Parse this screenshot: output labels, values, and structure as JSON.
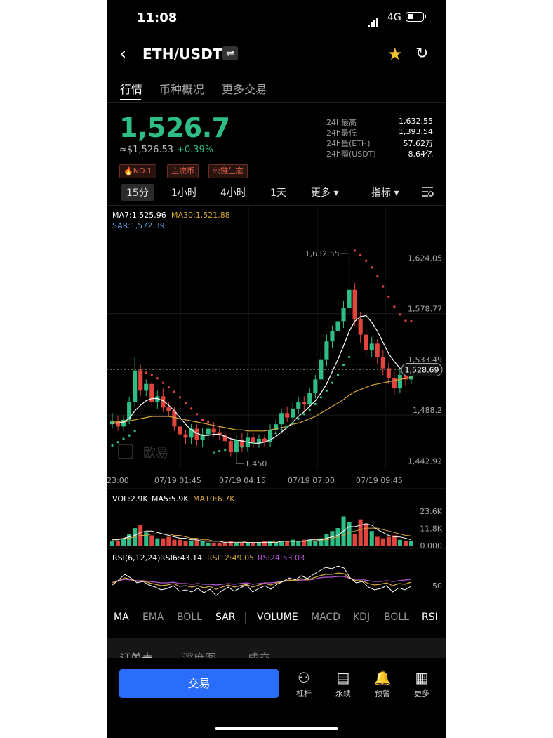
{
  "status_bar": {
    "time": "11:08",
    "network": "4G"
  },
  "header": {
    "back": "‹",
    "pair": "ETH/USDT",
    "swap_icon": "⇌",
    "star_icon": "★",
    "share_icon": "↻"
  },
  "tabs": [
    {
      "label": "行情"
    },
    {
      "label": "币种概况"
    },
    {
      "label": "更多交易"
    }
  ],
  "ticker": {
    "price": "1,526.7",
    "fiat": "≈$1,526.53",
    "change": "+0.39%",
    "stats": [
      {
        "label": "24h最高",
        "value": "1,632.55"
      },
      {
        "label": "24h最低",
        "value": "1,393.54"
      },
      {
        "label": "24h量(ETH)",
        "value": "57.62万"
      },
      {
        "label": "24h额(USDT)",
        "value": "8.64亿"
      }
    ],
    "tags": [
      "🔥NO.1",
      "主流币",
      "公链生态"
    ]
  },
  "timeframes": [
    {
      "label": "15分"
    },
    {
      "label": "1小时"
    },
    {
      "label": "4小时"
    },
    {
      "label": "1天"
    },
    {
      "label": "更多 ▾"
    },
    {
      "label": "指标 ▾"
    }
  ],
  "main_legend": {
    "ma7": "MA7:1,525.96",
    "ma30": "MA30:1,521.88",
    "sar": "SAR:1,572.39"
  },
  "price_axis": [
    "1,624.05",
    "1,578.77",
    "1,533.49",
    "1,488.2",
    "1,442.92"
  ],
  "current_price_tag": "1,528.69",
  "high_marker": "1,632.55",
  "low_marker": "1,450",
  "watermark": "欧易",
  "time_axis": [
    "23:00",
    "07/19 01:45",
    "07/19 04:15",
    "07/19 07:00",
    "07/19 09:45"
  ],
  "volume_legend": {
    "vol": "VOL:2.9K",
    "ma5": "MA5:5.9K",
    "ma10": "MA10:6.7K"
  },
  "volume_axis": [
    "23.6K",
    "11.8K",
    "0.000"
  ],
  "rsi_legend": {
    "label": "RSI(6,12,24)",
    "rsi6": "RSI6:43.14",
    "rsi12": "RSI12:49.05",
    "rsi24": "RSI24:53.03"
  },
  "rsi_axis": "50",
  "indicator_tabs": [
    "MA",
    "EMA",
    "BOLL",
    "SAR",
    "VOLUME",
    "MACD",
    "KDJ",
    "BOLL",
    "RSI"
  ],
  "orderbook_tabs": [
    "订单表",
    "深度图",
    "成交"
  ],
  "bottom_nav": {
    "trade_button": "交易",
    "items": [
      {
        "label": "杠杆",
        "icon": "⚇"
      },
      {
        "label": "永续",
        "icon": "▤"
      },
      {
        "label": "预警",
        "icon": "🔔"
      },
      {
        "label": "更多",
        "icon": "▦"
      }
    ]
  },
  "colors": {
    "up": "#2ebd85",
    "down": "#e0443d",
    "ma7": "#ffffff",
    "ma30": "#d8a73a",
    "sar": "#5ba0e6",
    "rsi24": "#b657d6",
    "accent": "#2a6dfb"
  },
  "chart_data": [
    {
      "type": "candlestick",
      "y_axis_ticks": [
        1624.05,
        1578.77,
        1533.49,
        1488.2,
        1442.92
      ],
      "ylim": [
        1442.92,
        1650
      ],
      "x_tick_labels": [
        "23:00",
        "07/19 01:45",
        "07/19 04:15",
        "07/19 07:00",
        "07/19 09:45"
      ],
      "annotations": {
        "high": 1632.55,
        "low": 1450,
        "last": 1528.69
      },
      "candles": [
        [
          1480,
          1483,
          1476,
          1490
        ],
        [
          1483,
          1478,
          1474,
          1487
        ],
        [
          1478,
          1484,
          1474,
          1488
        ],
        [
          1484,
          1500,
          1480,
          1504
        ],
        [
          1500,
          1528,
          1495,
          1540
        ],
        [
          1528,
          1510,
          1505,
          1533
        ],
        [
          1510,
          1516,
          1505,
          1520
        ],
        [
          1516,
          1500,
          1495,
          1518
        ],
        [
          1500,
          1505,
          1494,
          1510
        ],
        [
          1505,
          1495,
          1491,
          1512
        ],
        [
          1495,
          1492,
          1487,
          1500
        ],
        [
          1492,
          1478,
          1474,
          1495
        ],
        [
          1478,
          1471,
          1466,
          1482
        ],
        [
          1471,
          1468,
          1462,
          1475
        ],
        [
          1468,
          1476,
          1462,
          1480
        ],
        [
          1476,
          1466,
          1461,
          1480
        ],
        [
          1466,
          1471,
          1460,
          1477
        ],
        [
          1471,
          1476,
          1466,
          1480
        ],
        [
          1476,
          1473,
          1469,
          1482
        ],
        [
          1473,
          1470,
          1466,
          1478
        ],
        [
          1470,
          1465,
          1461,
          1474
        ],
        [
          1465,
          1455,
          1451,
          1468
        ],
        [
          1455,
          1466,
          1450,
          1470
        ],
        [
          1466,
          1460,
          1455,
          1472
        ],
        [
          1460,
          1468,
          1456,
          1473
        ],
        [
          1468,
          1463,
          1459,
          1472
        ],
        [
          1463,
          1467,
          1459,
          1471
        ],
        [
          1467,
          1464,
          1460,
          1471
        ],
        [
          1464,
          1475,
          1460,
          1480
        ],
        [
          1475,
          1480,
          1472,
          1485
        ],
        [
          1480,
          1490,
          1476,
          1494
        ],
        [
          1490,
          1486,
          1482,
          1496
        ],
        [
          1486,
          1494,
          1483,
          1499
        ],
        [
          1494,
          1500,
          1489,
          1504
        ],
        [
          1500,
          1498,
          1492,
          1505
        ],
        [
          1498,
          1508,
          1495,
          1512
        ],
        [
          1508,
          1520,
          1503,
          1524
        ],
        [
          1520,
          1538,
          1516,
          1545
        ],
        [
          1538,
          1554,
          1532,
          1560
        ],
        [
          1554,
          1563,
          1548,
          1568
        ],
        [
          1563,
          1572,
          1556,
          1577
        ],
        [
          1572,
          1584,
          1566,
          1590
        ],
        [
          1584,
          1600,
          1576,
          1632.55
        ],
        [
          1600,
          1574,
          1568,
          1606
        ],
        [
          1574,
          1560,
          1553,
          1580
        ],
        [
          1560,
          1546,
          1540,
          1565
        ],
        [
          1546,
          1552,
          1540,
          1558
        ],
        [
          1552,
          1540,
          1534,
          1556
        ],
        [
          1540,
          1530,
          1524,
          1546
        ],
        [
          1530,
          1521,
          1516,
          1535
        ],
        [
          1521,
          1512,
          1506,
          1527
        ],
        [
          1512,
          1524,
          1508,
          1530
        ],
        [
          1524,
          1520,
          1514,
          1530
        ],
        [
          1520,
          1528.69,
          1516,
          1532
        ]
      ],
      "ma7": [
        1481,
        1481,
        1482,
        1485,
        1492,
        1497,
        1501,
        1503,
        1503,
        1501,
        1497,
        1492,
        1486,
        1480,
        1475,
        1472,
        1470,
        1470,
        1471,
        1471,
        1469,
        1467,
        1466,
        1465,
        1464,
        1463,
        1463,
        1464,
        1466,
        1469,
        1473,
        1477,
        1482,
        1487,
        1491,
        1496,
        1501,
        1508,
        1516,
        1527,
        1538,
        1550,
        1563,
        1572,
        1576,
        1577,
        1571,
        1563,
        1553,
        1543,
        1536,
        1530,
        1525,
        1526
      ],
      "ma30": [
        1482,
        1482,
        1482,
        1483,
        1484,
        1485,
        1486,
        1487,
        1487,
        1487,
        1487,
        1486,
        1485,
        1484,
        1483,
        1482,
        1481,
        1480,
        1479,
        1478,
        1477,
        1476,
        1475,
        1475,
        1474,
        1474,
        1474,
        1474,
        1475,
        1476,
        1477,
        1478,
        1480,
        1481,
        1483,
        1485,
        1487,
        1490,
        1493,
        1496,
        1499,
        1502,
        1506,
        1509,
        1511,
        1513,
        1515,
        1516,
        1517,
        1518,
        1519,
        1520,
        1521,
        1521.88
      ],
      "sar": [
        1461,
        1464,
        1467,
        1470,
        1474,
        1528,
        1526,
        1524,
        1521,
        1517,
        1513,
        1509,
        1504,
        1499,
        1494,
        1489,
        1484,
        1482,
        1455,
        1456,
        1457,
        1458,
        1459,
        1460,
        1462,
        1463,
        1465,
        1467,
        1469,
        1472,
        1475,
        1478,
        1481,
        1485,
        1489,
        1493,
        1498,
        1504,
        1510,
        1517,
        1524,
        1533,
        1540,
        1635,
        1631,
        1626,
        1620,
        1612,
        1603,
        1594,
        1585,
        1578,
        1572.39,
        1572
      ]
    },
    {
      "type": "bar",
      "title": "VOL",
      "y_axis_ticks": [
        23.6,
        11.8,
        0
      ],
      "ylim": [
        0,
        26
      ],
      "values": [
        3,
        3,
        5,
        8,
        12,
        14,
        9,
        7,
        5,
        5,
        6,
        4,
        4,
        3,
        3,
        4,
        3,
        2,
        2,
        2,
        2,
        3,
        2,
        2,
        2,
        2,
        2,
        3,
        3,
        2,
        3,
        3,
        4,
        3,
        4,
        4,
        3,
        5,
        8,
        10,
        12,
        20,
        16,
        8,
        18,
        15,
        10,
        6,
        5,
        6,
        7,
        4,
        3,
        2.9
      ],
      "ma5": [
        4,
        4,
        5,
        6,
        7,
        9,
        10,
        10,
        9,
        8,
        7,
        6,
        5,
        5,
        4,
        4,
        3,
        3,
        3,
        3,
        2,
        2,
        2,
        2,
        2,
        2,
        2,
        2,
        2,
        2,
        3,
        3,
        3,
        3,
        3,
        4,
        4,
        4,
        5,
        6,
        7,
        10,
        13,
        13,
        14,
        15,
        14,
        11,
        9,
        7,
        6,
        5.9,
        5,
        4
      ],
      "ma10": [
        4,
        4,
        5,
        5,
        6,
        7,
        7,
        8,
        8,
        8,
        8,
        7,
        7,
        6,
        5,
        5,
        4,
        4,
        3,
        3,
        3,
        3,
        3,
        3,
        2,
        2,
        2,
        2,
        2,
        3,
        3,
        3,
        3,
        3,
        3,
        3,
        3,
        4,
        4,
        5,
        6,
        7,
        9,
        10,
        11,
        12,
        12,
        12,
        11,
        10,
        9,
        8,
        7,
        6.7
      ]
    },
    {
      "type": "line",
      "title": "RSI(6,12,24)",
      "y_axis_ticks": [
        50
      ],
      "ylim": [
        20,
        80
      ],
      "rsi6": [
        45,
        52,
        60,
        55,
        48,
        50,
        45,
        42,
        38,
        40,
        44,
        36,
        38,
        35,
        40,
        34,
        39,
        30,
        37,
        42,
        36,
        41,
        45,
        35,
        40,
        44,
        39,
        46,
        50,
        55,
        52,
        58,
        54,
        60,
        65,
        70,
        68,
        72,
        69,
        55,
        48,
        50,
        42,
        38,
        40,
        44,
        35,
        41,
        38,
        43.14
      ],
      "rsi12": [
        48,
        51,
        55,
        53,
        50,
        51,
        48,
        46,
        44,
        45,
        47,
        43,
        44,
        42,
        44,
        41,
        43,
        39,
        42,
        45,
        42,
        44,
        46,
        42,
        45,
        47,
        45,
        48,
        50,
        52,
        51,
        54,
        52,
        55,
        58,
        60,
        60,
        62,
        61,
        54,
        51,
        51,
        47,
        45,
        46,
        48,
        44,
        47,
        46,
        49.05
      ],
      "rsi24": [
        50,
        51,
        53,
        52,
        51,
        51,
        50,
        49,
        48,
        48,
        49,
        47,
        47,
        46,
        47,
        46,
        46,
        45,
        46,
        47,
        46,
        47,
        48,
        46,
        47,
        48,
        48,
        49,
        50,
        51,
        51,
        52,
        52,
        53,
        55,
        56,
        56,
        57,
        57,
        54,
        53,
        53,
        51,
        50,
        50,
        51,
        50,
        51,
        52,
        53.03
      ]
    }
  ]
}
